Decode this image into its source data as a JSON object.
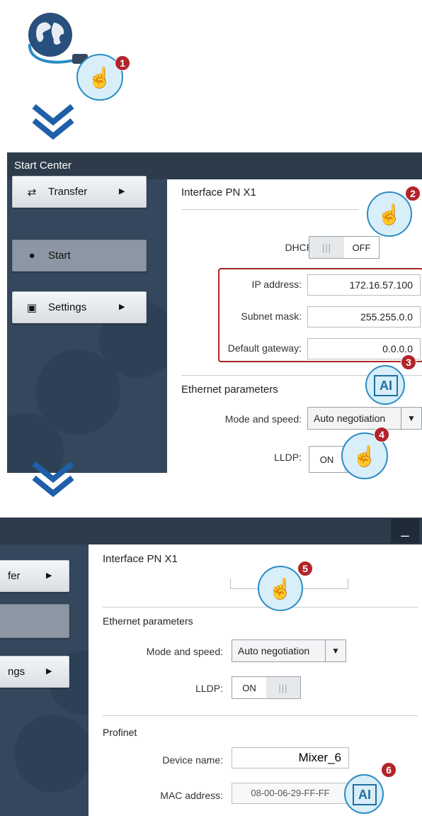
{
  "steps": [
    "1",
    "2",
    "3",
    "4",
    "5",
    "6"
  ],
  "panel1": {
    "title": "Start Center",
    "nav": [
      {
        "label": "Transfer",
        "icon": "transfer-icon"
      },
      {
        "label": "Start",
        "icon": "play-icon"
      },
      {
        "label": "Settings",
        "icon": "settings-icon"
      }
    ],
    "section_interface": "Interface PN X1",
    "dhcp_label": "DHCP:",
    "dhcp_value": "OFF",
    "ip_label": "IP address:",
    "ip_value": "172.16.57.100",
    "subnet_label": "Subnet mask:",
    "subnet_value": "255.255.0.0",
    "gateway_label": "Default gateway:",
    "gateway_value": "0.0.0.0",
    "section_ethernet": "Ethernet parameters",
    "mode_label": "Mode and speed:",
    "mode_value": "Auto negotiation",
    "lldp_label": "LLDP:",
    "lldp_value": "ON"
  },
  "panel2": {
    "nav": [
      {
        "label": "fer"
      },
      {
        "label": ""
      },
      {
        "label": "ngs"
      }
    ],
    "section_interface": "Interface PN X1",
    "section_ethernet": "Ethernet parameters",
    "mode_label": "Mode and speed:",
    "mode_value": "Auto negotiation",
    "lldp_label": "LLDP:",
    "lldp_value": "ON",
    "section_profinet": "Profinet",
    "device_label": "Device name:",
    "device_value": "Mixer_6",
    "mac_label": "MAC address:",
    "mac_value": "08-00-06-29-FF-FF",
    "minimize": "_"
  },
  "colors": {
    "accent": "#1e5fa8",
    "badge": "#b2252b",
    "titlebar": "#2d3b4a",
    "sidebar": "#34475c"
  }
}
